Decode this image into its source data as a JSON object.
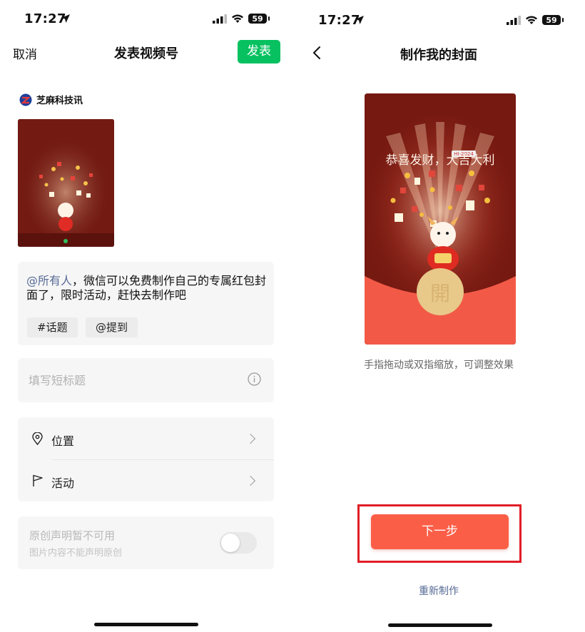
{
  "left": {
    "status": {
      "time": "17:27",
      "battery": "59"
    },
    "nav": {
      "cancel": "取消",
      "title": "发表视频号",
      "publish": "发表"
    },
    "account": {
      "name": "芝麻科技讯"
    },
    "caption": {
      "mention": "@所有人",
      "text": "，微信可以免费制作自己的专属红包封面了，限时活动，赶快去制作吧"
    },
    "chips": {
      "topic": "#话题",
      "mention": "@提到"
    },
    "short_title": {
      "placeholder": "填写短标题"
    },
    "rows": [
      {
        "label": "位置",
        "icon": "location-pin-icon"
      },
      {
        "label": "活动",
        "icon": "flag-icon"
      }
    ],
    "original": {
      "title": "原创声明暂不可用",
      "subtitle": "图片内容不能声明原创",
      "enabled": false
    }
  },
  "right": {
    "status": {
      "time": "17:27",
      "battery": "59"
    },
    "nav": {
      "title": "制作我的封面"
    },
    "cover": {
      "blessing": "恭喜发财，大吉大利",
      "open_char": "開",
      "mini_tag": "HI-2024"
    },
    "hint": "手指拖动或双指缩放，可调整效果",
    "next_button": "下一步",
    "remake_link": "重新制作"
  },
  "colors": {
    "wechat_green": "#07c160",
    "cover_dark_red": "#7a1a12",
    "cover_red": "#f25a47",
    "button_orange": "#fb5e47",
    "highlight_red": "#e01e26",
    "gold": "#e8c98a"
  }
}
